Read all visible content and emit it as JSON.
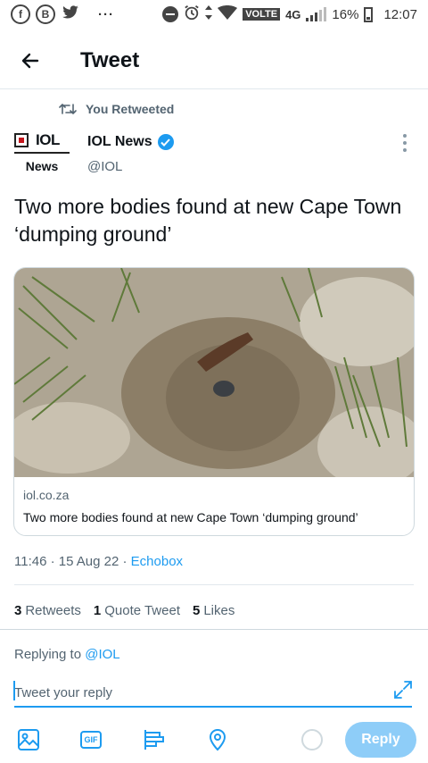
{
  "status_bar": {
    "carrier_badge": "VOLTE",
    "network": "4G",
    "battery": "16%",
    "time": "12:07",
    "overflow": "···",
    "icons": [
      "facebook-icon",
      "b-app-icon",
      "twitter-icon",
      "dnd-icon",
      "alarm-icon",
      "data-arrows-icon",
      "wifi-icon",
      "signal-icon",
      "battery-icon"
    ]
  },
  "header": {
    "title": "Tweet"
  },
  "retweet": {
    "label": "You Retweeted"
  },
  "author": {
    "name": "IOL News",
    "handle": "@IOL",
    "avatar_top": "IOL",
    "avatar_bottom": "News",
    "verified": true
  },
  "tweet": {
    "text": "Two more bodies found at new Cape Town ‘dumping ground’",
    "timestamp": "11:46 · 15 Aug 22 · ",
    "source": "Echobox"
  },
  "card": {
    "domain": "iol.co.za",
    "title": "Two more bodies found at new Cape Town ‘dumping ground’"
  },
  "stats": {
    "retweets_count": "3",
    "retweets_label": "Retweets",
    "quotes_count": "1",
    "quotes_label": "Quote Tweet",
    "likes_count": "5",
    "likes_label": "Likes"
  },
  "reply": {
    "replying_prefix": "Replying to ",
    "replying_handle": "@IOL",
    "placeholder": "Tweet your reply",
    "button_label": "Reply",
    "toolbar_icons": [
      "image-icon",
      "gif-icon",
      "poll-icon",
      "location-icon"
    ]
  },
  "colors": {
    "accent": "#1d9bf0",
    "reply_button_disabled": "#8ecdf8",
    "secondary_text": "#536471"
  }
}
